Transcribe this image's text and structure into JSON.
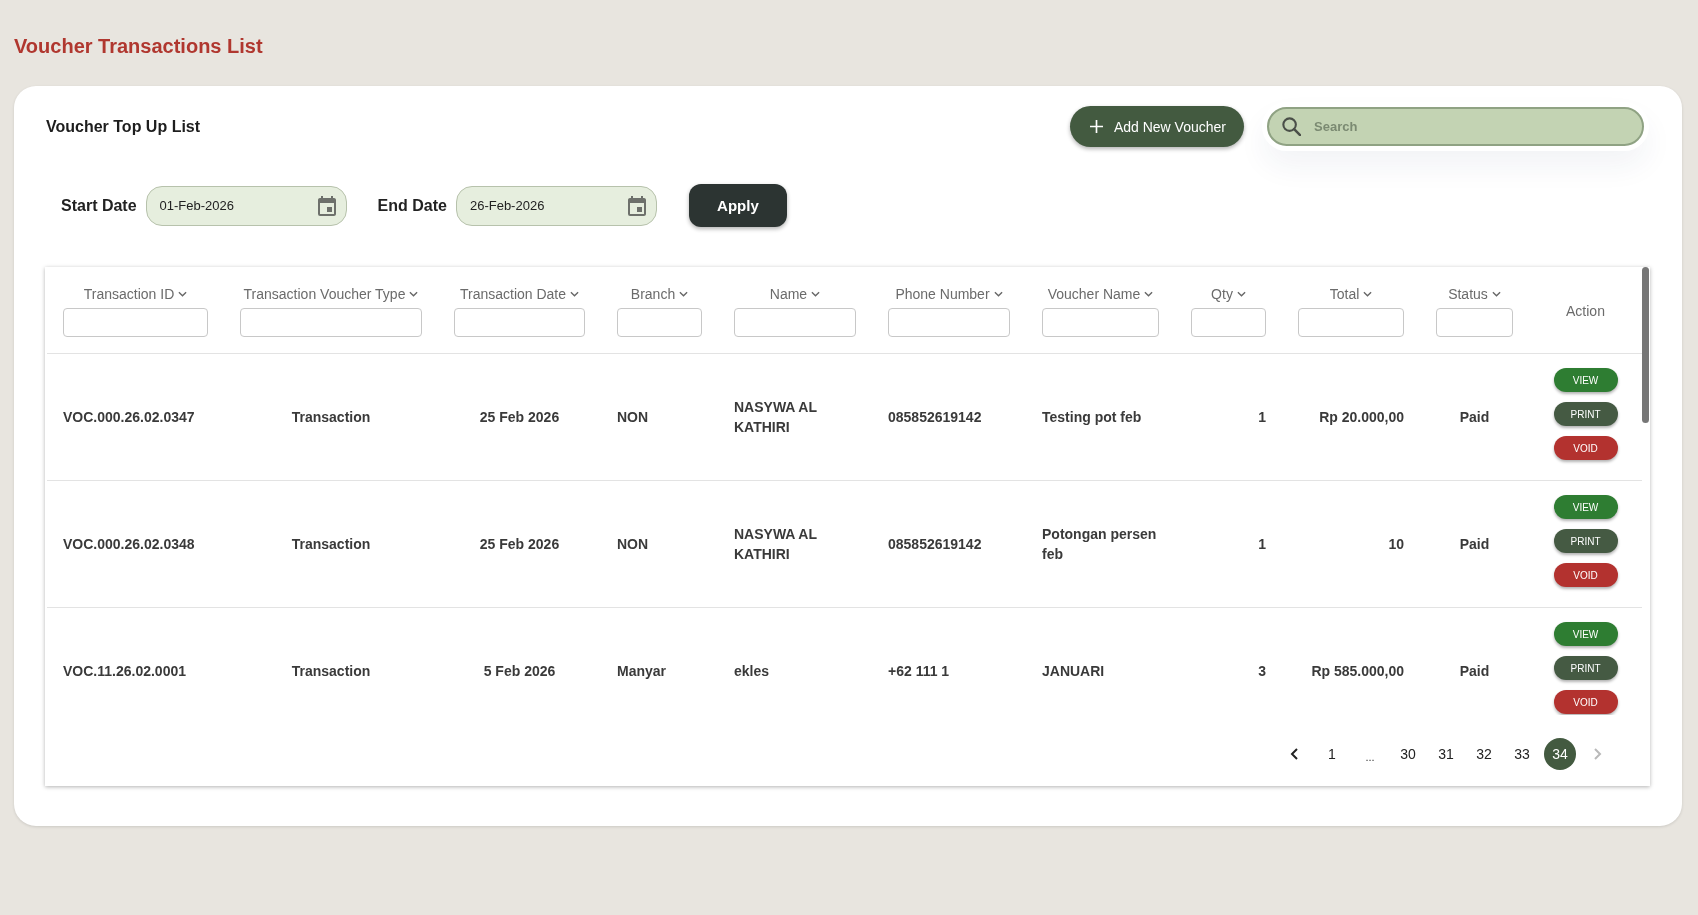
{
  "page_title": "Voucher Transactions List",
  "panel": {
    "title": "Voucher Top Up List",
    "add_button": {
      "label": "Add New Voucher"
    },
    "search": {
      "placeholder": "Search"
    },
    "date_filters": [
      {
        "label": "Start Date",
        "value": "01-Feb-2026"
      },
      {
        "label": "End Date",
        "value": "26-Feb-2026"
      }
    ],
    "apply_button": {
      "label": "Apply"
    },
    "table": {
      "columns": [
        {
          "label": "Transaction ID",
          "sortable": true,
          "filterable": true
        },
        {
          "label": "Transaction Voucher Type",
          "sortable": true,
          "filterable": true
        },
        {
          "label": "Transaction Date",
          "sortable": true,
          "filterable": true
        },
        {
          "label": "Branch",
          "sortable": true,
          "filterable": true
        },
        {
          "label": "Name",
          "sortable": true,
          "filterable": true
        },
        {
          "label": "Phone Number",
          "sortable": true,
          "filterable": true
        },
        {
          "label": "Voucher Name",
          "sortable": true,
          "filterable": true
        },
        {
          "label": "Qty",
          "sortable": true,
          "filterable": true
        },
        {
          "label": "Total",
          "sortable": true,
          "filterable": true
        },
        {
          "label": "Status",
          "sortable": true,
          "filterable": true
        },
        {
          "label": "Action",
          "sortable": false,
          "filterable": false
        }
      ],
      "rows": [
        {
          "cells": [
            "VOC.000.26.02.0347",
            "Transaction",
            "25 Feb 2026",
            "NON",
            "NASYWA AL KATHIRI",
            "085852619142",
            "Testing pot feb",
            "1",
            "Rp 20.000,00",
            "Paid"
          ],
          "actions": [
            {
              "kind": "view",
              "label": "VIEW"
            },
            {
              "kind": "print",
              "label": "PRINT"
            },
            {
              "kind": "void",
              "label": "VOID"
            }
          ]
        },
        {
          "cells": [
            "VOC.000.26.02.0348",
            "Transaction",
            "25 Feb 2026",
            "NON",
            "NASYWA AL KATHIRI",
            "085852619142",
            "Potongan persen feb",
            "1",
            "10",
            "Paid"
          ],
          "actions": [
            {
              "kind": "view",
              "label": "VIEW"
            },
            {
              "kind": "print",
              "label": "PRINT"
            },
            {
              "kind": "void",
              "label": "VOID"
            }
          ]
        },
        {
          "cells": [
            "VOC.11.26.02.0001",
            "Transaction",
            "5 Feb 2026",
            "Manyar",
            "ekles",
            "+62 111 1",
            "JANUARI",
            "3",
            "Rp 585.000,00",
            "Paid"
          ],
          "actions": [
            {
              "kind": "view",
              "label": "VIEW"
            },
            {
              "kind": "print",
              "label": "PRINT"
            },
            {
              "kind": "void",
              "label": "VOID"
            }
          ]
        }
      ]
    },
    "pagination": {
      "prev": {
        "disabled": false
      },
      "pages": [
        {
          "kind": "page",
          "label": "1",
          "selected": false
        },
        {
          "kind": "ellipsis",
          "label": "..."
        },
        {
          "kind": "page",
          "label": "30",
          "selected": false
        },
        {
          "kind": "page",
          "label": "31",
          "selected": false
        },
        {
          "kind": "page",
          "label": "32",
          "selected": false
        },
        {
          "kind": "page",
          "label": "33",
          "selected": false
        },
        {
          "kind": "page",
          "label": "34",
          "selected": true
        }
      ],
      "next": {
        "disabled": true
      }
    }
  }
}
